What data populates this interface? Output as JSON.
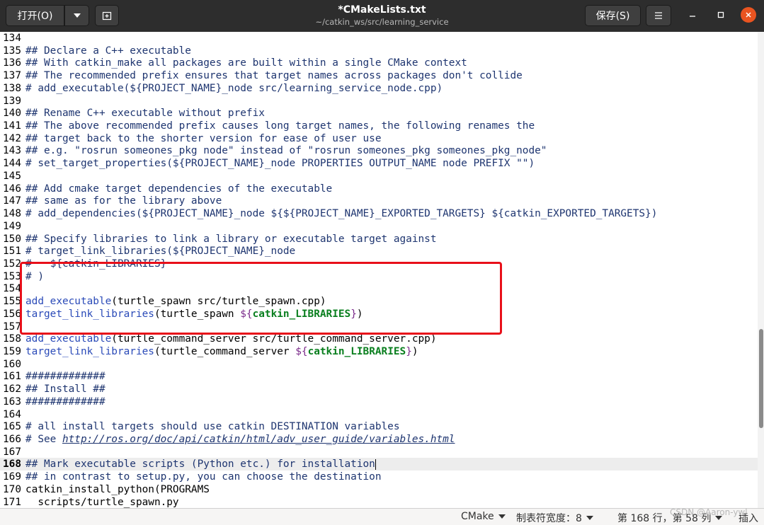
{
  "headerbar": {
    "open_label": "打开(O)",
    "save_label": "保存(S)",
    "title": "*CMakeLists.txt",
    "subtitle": "~/catkin_ws/src/learning_service"
  },
  "editor": {
    "current_line": 168,
    "lines": [
      {
        "n": "134",
        "segs": []
      },
      {
        "n": "135",
        "segs": [
          {
            "c": "cm",
            "t": "## Declare a C++ executable"
          }
        ]
      },
      {
        "n": "136",
        "segs": [
          {
            "c": "cm",
            "t": "## With catkin_make all packages are built within a single CMake context"
          }
        ]
      },
      {
        "n": "137",
        "segs": [
          {
            "c": "cm",
            "t": "## The recommended prefix ensures that target names across packages don't collide"
          }
        ]
      },
      {
        "n": "138",
        "segs": [
          {
            "c": "cm",
            "t": "# add_executable(${PROJECT_NAME}_node src/learning_service_node.cpp)"
          }
        ]
      },
      {
        "n": "139",
        "segs": []
      },
      {
        "n": "140",
        "segs": [
          {
            "c": "cm",
            "t": "## Rename C++ executable without prefix"
          }
        ]
      },
      {
        "n": "141",
        "segs": [
          {
            "c": "cm",
            "t": "## The above recommended prefix causes long target names, the following renames the"
          }
        ]
      },
      {
        "n": "142",
        "segs": [
          {
            "c": "cm",
            "t": "## target back to the shorter version for ease of user use"
          }
        ]
      },
      {
        "n": "143",
        "segs": [
          {
            "c": "cm",
            "t": "## e.g. \"rosrun someones_pkg node\" instead of \"rosrun someones_pkg someones_pkg_node\""
          }
        ]
      },
      {
        "n": "144",
        "segs": [
          {
            "c": "cm",
            "t": "# set_target_properties(${PROJECT_NAME}_node PROPERTIES OUTPUT_NAME node PREFIX \"\")"
          }
        ]
      },
      {
        "n": "145",
        "segs": []
      },
      {
        "n": "146",
        "segs": [
          {
            "c": "cm",
            "t": "## Add cmake target dependencies of the executable"
          }
        ]
      },
      {
        "n": "147",
        "segs": [
          {
            "c": "cm",
            "t": "## same as for the library above"
          }
        ]
      },
      {
        "n": "148",
        "segs": [
          {
            "c": "cm",
            "t": "# add_dependencies(${PROJECT_NAME}_node ${${PROJECT_NAME}_EXPORTED_TARGETS} ${catkin_EXPORTED_TARGETS})"
          }
        ]
      },
      {
        "n": "149",
        "segs": []
      },
      {
        "n": "150",
        "segs": [
          {
            "c": "cm",
            "t": "## Specify libraries to link a library or executable target against"
          }
        ]
      },
      {
        "n": "151",
        "segs": [
          {
            "c": "cm",
            "t": "# target_link_libraries(${PROJECT_NAME}_node"
          }
        ]
      },
      {
        "n": "152",
        "segs": [
          {
            "c": "cm",
            "t": "#   ${catkin_LIBRARIES}"
          }
        ]
      },
      {
        "n": "153",
        "segs": [
          {
            "c": "cm",
            "t": "# )"
          }
        ]
      },
      {
        "n": "154",
        "segs": []
      },
      {
        "n": "155",
        "segs": [
          {
            "c": "fn",
            "t": "add_executable"
          },
          {
            "c": "",
            "t": "(turtle_spawn src/turtle_spawn.cpp)"
          }
        ]
      },
      {
        "n": "156",
        "segs": [
          {
            "c": "fn",
            "t": "target_link_libraries"
          },
          {
            "c": "",
            "t": "(turtle_spawn "
          },
          {
            "c": "dl",
            "t": "${"
          },
          {
            "c": "vr",
            "t": "catkin_LIBRARIES"
          },
          {
            "c": "dl",
            "t": "}"
          },
          {
            "c": "",
            "t": ")"
          }
        ]
      },
      {
        "n": "157",
        "segs": []
      },
      {
        "n": "158",
        "segs": [
          {
            "c": "fn",
            "t": "add_executable"
          },
          {
            "c": "",
            "t": "(turtle_command_server src/turtle_command_server.cpp)"
          }
        ]
      },
      {
        "n": "159",
        "segs": [
          {
            "c": "fn",
            "t": "target_link_libraries"
          },
          {
            "c": "",
            "t": "(turtle_command_server "
          },
          {
            "c": "dl",
            "t": "${"
          },
          {
            "c": "vr",
            "t": "catkin_LIBRARIES"
          },
          {
            "c": "dl",
            "t": "}"
          },
          {
            "c": "",
            "t": ")"
          }
        ]
      },
      {
        "n": "160",
        "segs": []
      },
      {
        "n": "161",
        "segs": [
          {
            "c": "cm",
            "t": "#############"
          }
        ]
      },
      {
        "n": "162",
        "segs": [
          {
            "c": "cm",
            "t": "## Install ##"
          }
        ]
      },
      {
        "n": "163",
        "segs": [
          {
            "c": "cm",
            "t": "#############"
          }
        ]
      },
      {
        "n": "164",
        "segs": []
      },
      {
        "n": "165",
        "segs": [
          {
            "c": "cm",
            "t": "# all install targets should use catkin DESTINATION variables"
          }
        ]
      },
      {
        "n": "166",
        "segs": [
          {
            "c": "cm",
            "t": "# See "
          },
          {
            "c": "url",
            "t": "http://ros.org/doc/api/catkin/html/adv_user_guide/variables.html"
          }
        ]
      },
      {
        "n": "167",
        "segs": []
      },
      {
        "n": "168",
        "segs": [
          {
            "c": "cm",
            "t": "## Mark executable scripts (Python etc.) for installation"
          }
        ]
      },
      {
        "n": "169",
        "segs": [
          {
            "c": "cm",
            "t": "## in contrast to setup.py, you can choose the destination"
          }
        ]
      },
      {
        "n": "170",
        "segs": [
          {
            "c": "",
            "t": "catkin_install_python(PROGRAMS"
          }
        ]
      },
      {
        "n": "171",
        "segs": [
          {
            "c": "",
            "t": "  scripts/turtle_spawn.py"
          }
        ]
      }
    ]
  },
  "statusbar": {
    "language": "CMake",
    "tab_width": "制表符宽度：8",
    "position": "第 168 行，第 58 列",
    "mode": "插入",
    "watermark": "CSDN @Aaron-ywl"
  },
  "colors": {
    "highlight_box": "#e8101a",
    "close_button": "#e95420",
    "comment": "#1e3570",
    "function": "#2a4ab8",
    "variable": "#0a7f1f"
  }
}
